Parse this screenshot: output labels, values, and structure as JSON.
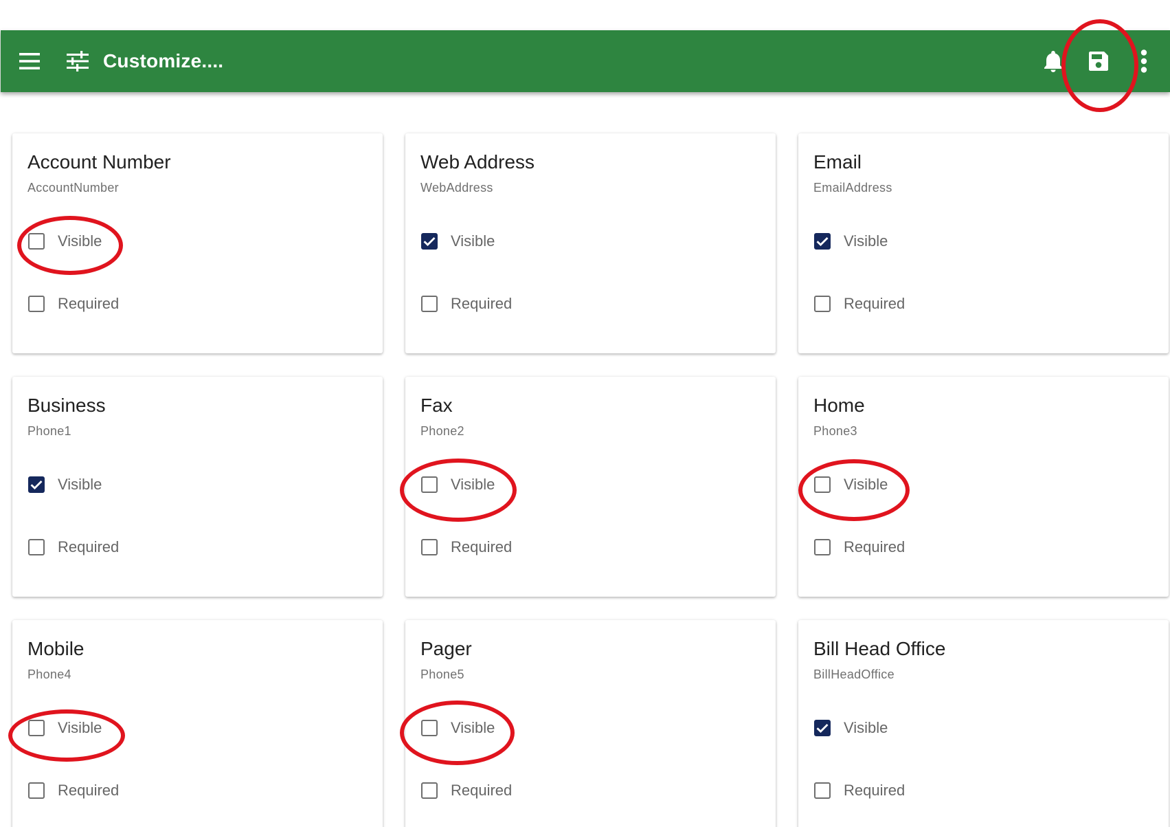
{
  "toolbar": {
    "title": "Customize....",
    "background": "#2e8540",
    "icons": [
      "menu-icon",
      "tune-icon",
      "bell-icon",
      "save-icon",
      "more-vert-icon"
    ]
  },
  "checkbox_checked_color": "#15285c",
  "annotation_color": "#e0141e",
  "cards": [
    {
      "title": "Account Number",
      "subtitle": "AccountNumber",
      "visible_label": "Visible",
      "visible": false,
      "required_label": "Required",
      "required": false
    },
    {
      "title": "Web Address",
      "subtitle": "WebAddress",
      "visible_label": "Visible",
      "visible": true,
      "required_label": "Required",
      "required": false
    },
    {
      "title": "Email",
      "subtitle": "EmailAddress",
      "visible_label": "Visible",
      "visible": true,
      "required_label": "Required",
      "required": false
    },
    {
      "title": "Business",
      "subtitle": "Phone1",
      "visible_label": "Visible",
      "visible": true,
      "required_label": "Required",
      "required": false
    },
    {
      "title": "Fax",
      "subtitle": "Phone2",
      "visible_label": "Visible",
      "visible": false,
      "required_label": "Required",
      "required": false
    },
    {
      "title": "Home",
      "subtitle": "Phone3",
      "visible_label": "Visible",
      "visible": false,
      "required_label": "Required",
      "required": false
    },
    {
      "title": "Mobile",
      "subtitle": "Phone4",
      "visible_label": "Visible",
      "visible": false,
      "required_label": "Required",
      "required": false
    },
    {
      "title": "Pager",
      "subtitle": "Phone5",
      "visible_label": "Visible",
      "visible": false,
      "required_label": "Required",
      "required": false
    },
    {
      "title": "Bill Head Office",
      "subtitle": "BillHeadOffice",
      "visible_label": "Visible",
      "visible": true,
      "required_label": "Required",
      "required": false
    }
  ]
}
